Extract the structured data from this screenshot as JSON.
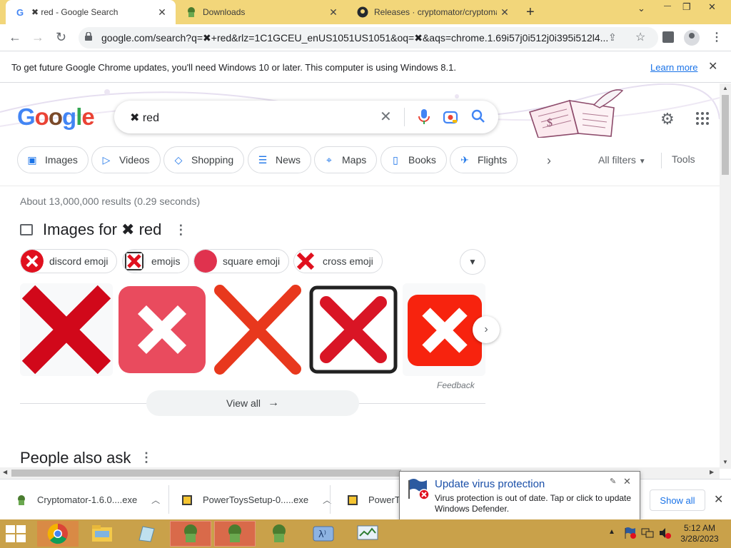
{
  "tabs": [
    {
      "title": "✖ red - Google Search",
      "favicon": "google-icon",
      "active": true
    },
    {
      "title": "Downloads",
      "favicon": "cryptomator-icon",
      "active": false
    },
    {
      "title": "Releases · cryptomator/cryptoma",
      "favicon": "github-icon",
      "active": false
    }
  ],
  "window": {
    "new_tab": "+",
    "chevron": "⌄",
    "minimize": "—",
    "restore": "❐",
    "close": "✕"
  },
  "omnibox": {
    "url": "google.com/search?q=✖+red&rlz=1C1GCEU_enUS1051US1051&oq=✖&aqs=chrome.1.69i57j0i512j0i395i512l4..."
  },
  "infobar": {
    "message": "To get future Google Chrome updates, you'll need Windows 10 or later. This computer is using Windows 8.1.",
    "link": "Learn more"
  },
  "search": {
    "query": "✖ red"
  },
  "filters": {
    "chips": [
      {
        "label": "Images",
        "icon": "image-icon"
      },
      {
        "label": "Videos",
        "icon": "video-icon"
      },
      {
        "label": "Shopping",
        "icon": "tag-icon"
      },
      {
        "label": "News",
        "icon": "news-icon"
      },
      {
        "label": "Maps",
        "icon": "map-pin-icon"
      },
      {
        "label": "Books",
        "icon": "book-icon"
      },
      {
        "label": "Flights",
        "icon": "plane-icon"
      }
    ],
    "all_filters": "All filters",
    "tools": "Tools"
  },
  "results": {
    "stats": "About 13,000,000 results (0.29 seconds)",
    "images_title": "Images for ✖ red",
    "related": [
      {
        "label": "discord emoji"
      },
      {
        "label": "emojis"
      },
      {
        "label": "square emoji"
      },
      {
        "label": "cross emoji"
      }
    ],
    "feedback": "Feedback",
    "view_all": "View all",
    "people_also_ask": "People also ask"
  },
  "downloads": {
    "items": [
      {
        "name": "Cryptomator-1.6.0....exe"
      },
      {
        "name": "PowerToysSetup-0.....exe"
      },
      {
        "name": "PowerTo"
      }
    ],
    "show_all": "Show all"
  },
  "notification": {
    "title": "Update virus protection",
    "body": "Virus protection is out of date. Tap or click to update Windows Defender."
  },
  "clock": {
    "time": "5:12 AM",
    "date": "3/28/2023"
  },
  "colors": {
    "tabbar": "#f2d67a",
    "taskbar": "#c9a14a",
    "accent": "#1a73e8",
    "red_x": "#e0101e"
  }
}
